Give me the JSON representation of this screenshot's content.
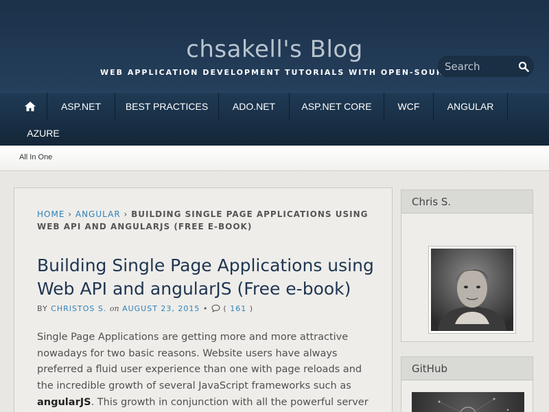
{
  "header": {
    "title": "chsakell's Blog",
    "description": "WEB APPLICATION DEVELOPMENT TUTORIALS WITH OPEN-SOURCE PROJECTS",
    "search_placeholder": "Search"
  },
  "nav": {
    "home_icon": "home-icon",
    "items": [
      "ASP.NET",
      "BEST PRACTICES",
      "ADO.NET",
      "ASP.NET CORE",
      "WCF",
      "ANGULAR",
      "AZURE"
    ]
  },
  "subnav": {
    "items": [
      "All In One"
    ]
  },
  "breadcrumb": {
    "home": "HOME",
    "sep": "›",
    "category": "ANGULAR",
    "current": "BUILDING SINGLE PAGE APPLICATIONS USING WEB API AND ANGULARJS (FREE E-BOOK)"
  },
  "post": {
    "title": "Building Single Page Applications using Web API and angularJS (Free e-book)",
    "meta": {
      "by": "BY",
      "author": "CHRISTOS S.",
      "on": "on",
      "date": "AUGUST 23, 2015",
      "bullet": "•",
      "comment_icon": "comment-icon",
      "comments_open": "(",
      "comments": "161",
      "comments_close": ")"
    },
    "body_1": "Single Page Applications are getting more and more attractive nowadays for two basic reasons. Website users have always preferred a fluid user experience than one with page reloads and the incredible growth of several JavaScript frameworks such as ",
    "body_bold": "angularJS",
    "body_2": ". This growth in conjunction with all the powerful server side frameworks"
  },
  "sidebar": {
    "widgets": [
      {
        "title": "Chris S.",
        "image": "profile-photo"
      },
      {
        "title": "GitHub",
        "image": "github-banner"
      }
    ]
  },
  "colors": {
    "header_bg": "#1b3149",
    "nav_bg": "#1a3047",
    "link": "#2f80b7",
    "title": "#1f3651"
  }
}
